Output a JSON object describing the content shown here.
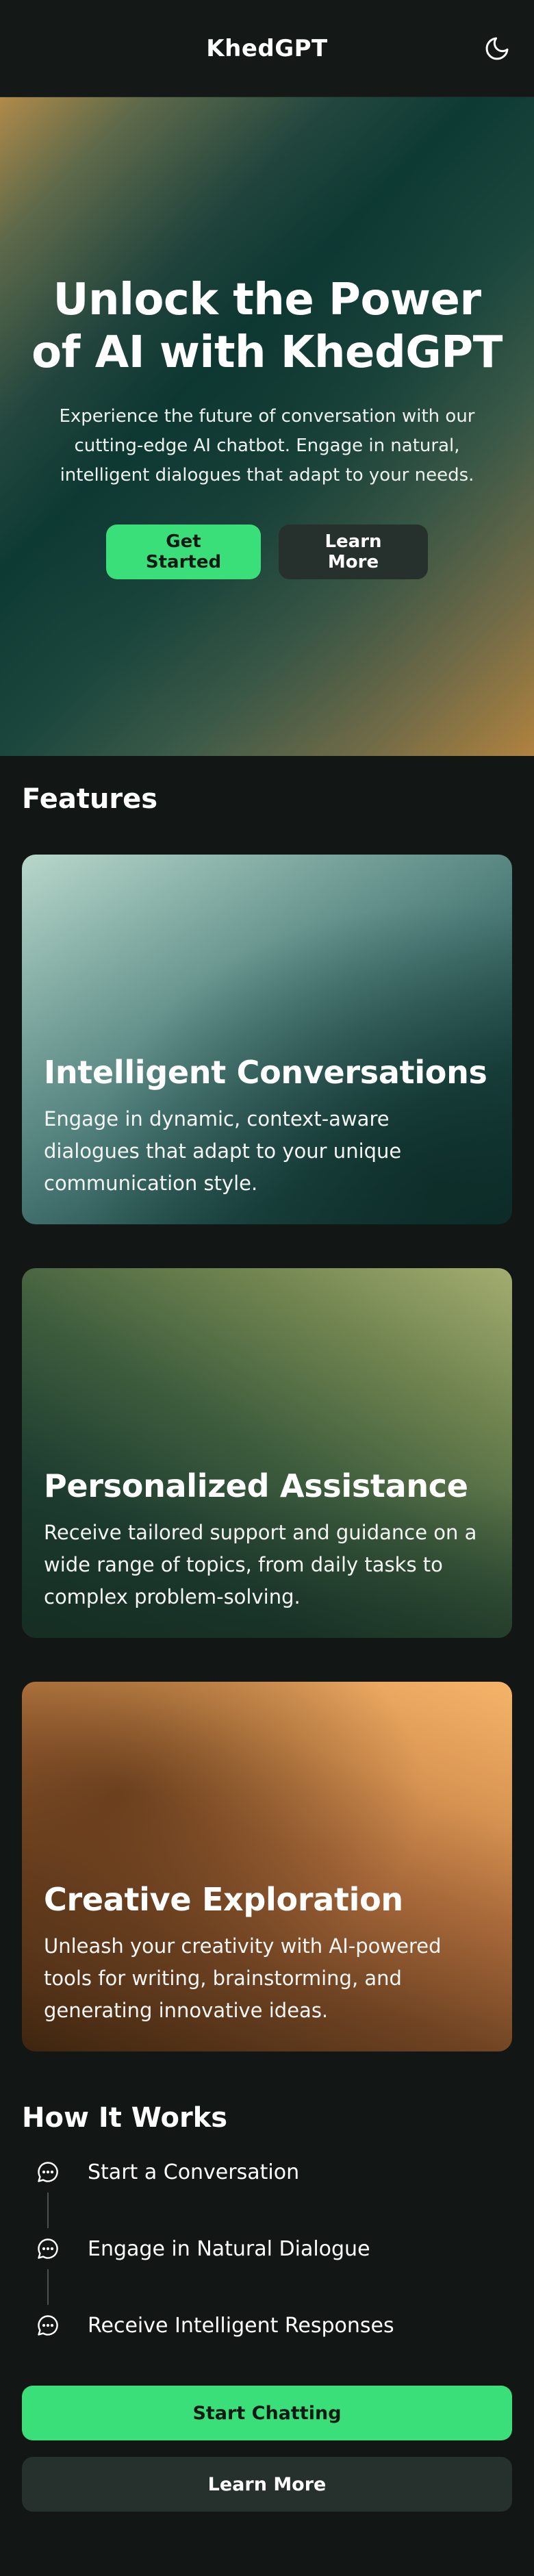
{
  "header": {
    "brand": "KhedGPT",
    "theme_icon": "moon-icon"
  },
  "hero": {
    "title": "Unlock the Power of AI with KhedGPT",
    "subtitle": "Experience the future of conversation with our cutting-edge AI chatbot. Engage in natural, intelligent dialogues that adapt to your needs.",
    "primary_label": "Get Started",
    "secondary_label": "Learn More"
  },
  "features": {
    "title": "Features",
    "items": [
      {
        "title": "Intelligent Conversations",
        "description": "Engage in dynamic, context-aware dialogues that adapt to your unique communication style."
      },
      {
        "title": "Personalized Assistance",
        "description": "Receive tailored support and guidance on a wide range of topics, from daily tasks to complex problem-solving."
      },
      {
        "title": "Creative Exploration",
        "description": "Unleash your creativity with AI-powered tools for writing, brainstorming, and generating innovative ideas."
      }
    ]
  },
  "how_it_works": {
    "title": "How It Works",
    "step_icon": "chat-bubble-icon",
    "steps": [
      {
        "label": "Start a Conversation"
      },
      {
        "label": "Engage in Natural Dialogue"
      },
      {
        "label": "Receive Intelligent Responses"
      }
    ],
    "primary_label": "Start Chatting",
    "secondary_label": "Learn More"
  },
  "colors": {
    "accent": "#3bdf7a",
    "background": "#121715",
    "secondary_button": "#26302c"
  }
}
